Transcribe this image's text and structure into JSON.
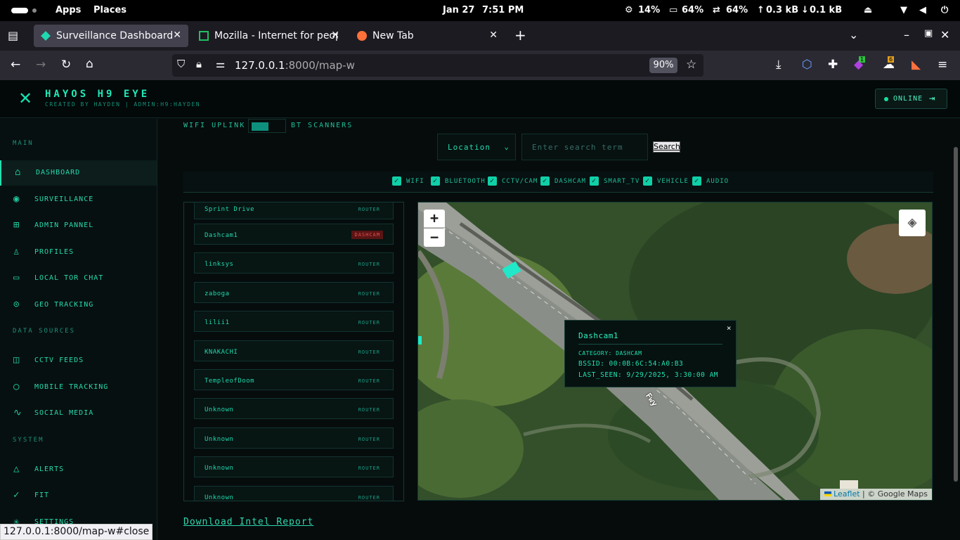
{
  "system_bar": {
    "apps": "Apps",
    "places": "Places",
    "date": "Jan 27",
    "time": "7:51 PM",
    "cpu": "14%",
    "mem": "64%",
    "swap": "64%",
    "up": "0.3 kB",
    "down": "0.1 kB"
  },
  "tabs": [
    {
      "label": "Surveillance Dashboard",
      "active": true
    },
    {
      "label": "Mozilla - Internet for peop",
      "active": false
    },
    {
      "label": "New Tab",
      "active": false
    }
  ],
  "nav": {
    "url_host": "127.0.0.1",
    "url_rest": ":8000/map-w",
    "zoom": "90%",
    "notification_badge_1": "1",
    "notification_badge_2": "6"
  },
  "app": {
    "brand": "HAYOS H9 EYE",
    "subtitle": "CREATED BY HAYDEN | ADMIN:H9:HAYDEN",
    "status": "ONLINE"
  },
  "sidebar": {
    "sections": {
      "main": "MAIN",
      "data_sources": "DATA SOURCES",
      "system": "SYSTEM"
    },
    "items": [
      {
        "label": "DASHBOARD",
        "icon": "home-icon"
      },
      {
        "label": "SURVEILLANCE",
        "icon": "eye-icon"
      },
      {
        "label": "ADMIN PANNEL",
        "icon": "grid-icon"
      },
      {
        "label": "PROFILES",
        "icon": "user-icon"
      },
      {
        "label": "LOCAL TOR CHAT",
        "icon": "chat-icon"
      },
      {
        "label": "GEO TRACKING",
        "icon": "pin-icon"
      },
      {
        "label": "CCTV FEEDS",
        "icon": "camera-icon"
      },
      {
        "label": "MOBILE TRACKING",
        "icon": "search-icon"
      },
      {
        "label": "SOCIAL MEDIA",
        "icon": "pulse-icon"
      },
      {
        "label": "ALERTS",
        "icon": "alert-icon"
      },
      {
        "label": "FIT",
        "icon": "check-icon"
      },
      {
        "label": "SETTINGS",
        "icon": "gear-icon"
      }
    ]
  },
  "main": {
    "wifi_uplink": "WIFI UPLINK",
    "bt_scanners": "BT SCANNERS",
    "location_select": "Location",
    "search_placeholder": "Enter search term",
    "search_button": "Search",
    "filters": [
      "WIFI",
      "BLUETOOTH",
      "CCTV/CAM",
      "DASHCAM",
      "SMART_TV",
      "VEHICLE",
      "AUDIO"
    ],
    "devices": [
      {
        "name": "Sprint Drive",
        "type": "ROUTER"
      },
      {
        "name": "Dashcam1",
        "type": "DASHCAM"
      },
      {
        "name": "linksys",
        "type": "ROUTER"
      },
      {
        "name": "zaboga",
        "type": "ROUTER"
      },
      {
        "name": "lilii1",
        "type": "ROUTER"
      },
      {
        "name": "KNAKACHI",
        "type": "ROUTER"
      },
      {
        "name": "TempleofDoom",
        "type": "ROUTER"
      },
      {
        "name": "Unknown",
        "type": "ROUTER"
      },
      {
        "name": "Unknown",
        "type": "ROUTER"
      },
      {
        "name": "Unknown",
        "type": "ROUTER"
      },
      {
        "name": "Unknown",
        "type": "ROUTER"
      }
    ],
    "download": "Download Intel Report"
  },
  "map": {
    "zoom_in": "+",
    "zoom_out": "−",
    "road_label": "Fwy",
    "popup": {
      "title": "Dashcam1",
      "category": "CATEGORY: DASHCAM",
      "bssid": "BSSID: 00:0B:6C:54:A0:B3",
      "last_seen": "LAST_SEEN: 9/29/2025, 3:30:00 AM",
      "close": "×"
    },
    "attribution_leaflet": "Leaflet",
    "attribution_rest": " | © Google Maps"
  },
  "status_url": "127.0.0.1:8000/map-w#close",
  "colors": {
    "accent": "#20e0b0",
    "background": "#060c0c",
    "dashcam_badge": "#e05050"
  }
}
